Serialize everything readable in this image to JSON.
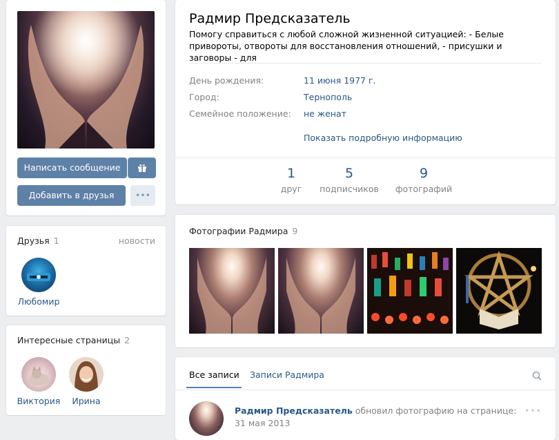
{
  "profile": {
    "name": "Радмир Предсказатель",
    "status": "Помогу справиться с любой сложной жизненной ситуацией: - Белые привороты, отвороты для восстановления отношений, - присушки и заговоры - для",
    "info": [
      {
        "label": "День рождения:",
        "value": "11 июня 1977 г."
      },
      {
        "label": "Город:",
        "value": "Тернополь"
      },
      {
        "label": "Семейное положение:",
        "value": "не женат"
      }
    ],
    "show_more": "Показать подробную информацию",
    "counters": [
      {
        "num": "1",
        "label": "друг"
      },
      {
        "num": "5",
        "label": "подписчиков"
      },
      {
        "num": "9",
        "label": "фотографий"
      }
    ]
  },
  "actions": {
    "message": "Написать сообщение",
    "add_friend": "Добавить в друзья",
    "more": "•••"
  },
  "friends": {
    "title": "Друзья",
    "count": "1",
    "news_link": "новости",
    "items": [
      {
        "name": "Любомир"
      }
    ]
  },
  "interesting": {
    "title": "Интересные страницы",
    "count": "2",
    "items": [
      {
        "name": "Виктория"
      },
      {
        "name": "Ирина"
      }
    ]
  },
  "photos": {
    "title": "Фотографии Радмира",
    "count": "9"
  },
  "wall": {
    "tabs": [
      {
        "label": "Все записи",
        "active": true
      },
      {
        "label": "Записи Радмира",
        "active": false
      }
    ],
    "post": {
      "author": "Радмир Предсказатель",
      "action": "обновил фотографию на странице:",
      "date": "31 мая 2013",
      "menu": "•••"
    }
  },
  "colors": {
    "accent": "#5e81a8",
    "link": "#2a5885",
    "background": "#edeef0"
  }
}
